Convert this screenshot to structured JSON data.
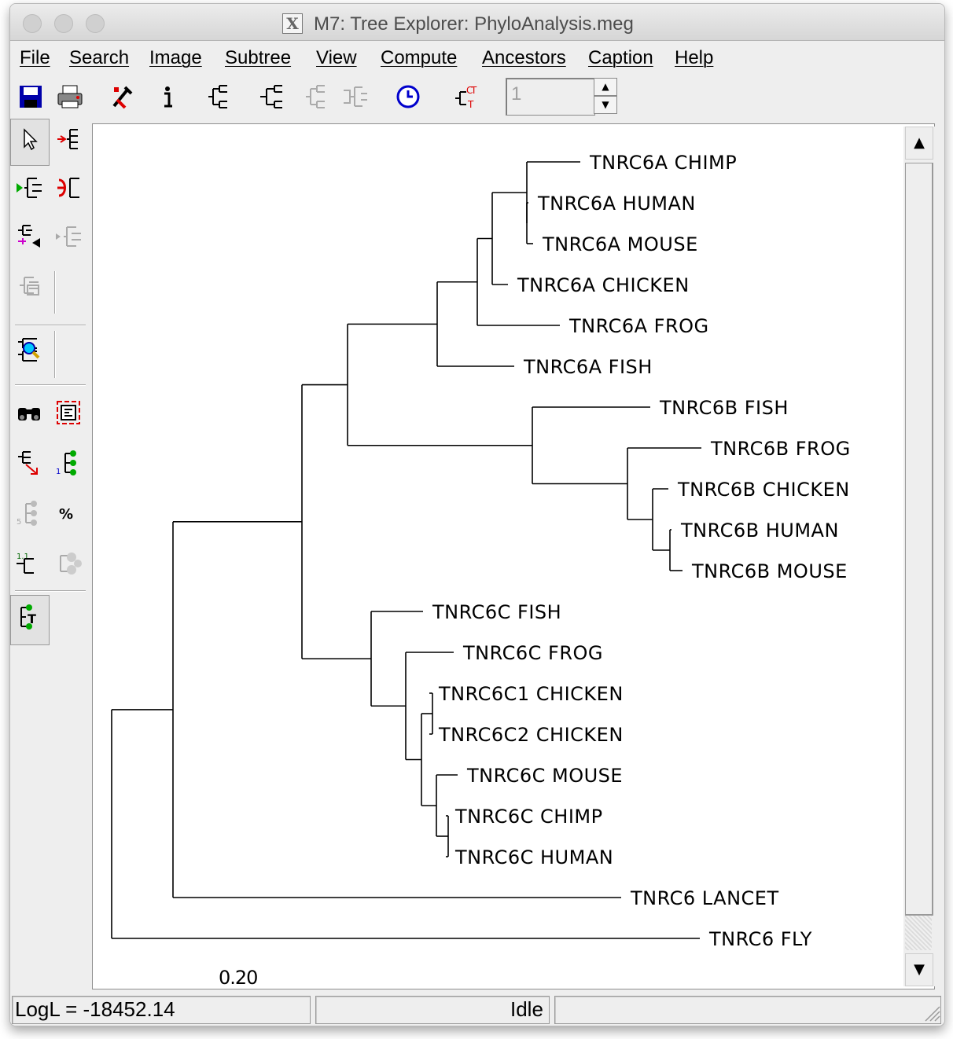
{
  "window": {
    "title": "M7: Tree Explorer: PhyloAnalysis.meg"
  },
  "menu": [
    "File",
    "Search",
    "Image",
    "Subtree",
    "View",
    "Compute",
    "Ancestors",
    "Caption",
    "Help"
  ],
  "toolbar": {
    "icons": [
      "save-icon",
      "print-icon",
      "tree-options-icon",
      "info-icon",
      "tree-style-icon",
      "tree-compress-icon",
      "tree-style-disabled-icon",
      "tree-flip-disabled-icon",
      "clock-icon",
      "taxon-names-icon"
    ],
    "spinner_value": "1"
  },
  "left_toolbar": {
    "icons": [
      "pointer-icon",
      "place-root-icon",
      "flip-subtree-icon",
      "compress-subtree-icon",
      "swap-subtree-icon",
      "subtree-disabled-icon",
      "subtree-window-disabled-icon",
      "search-taxa-icon",
      "binoculars-icon",
      "fit-window-icon",
      "resize-icon",
      "node-ids-icon",
      "branch-length-disabled-icon",
      "percent-icon",
      "scale-icon",
      "clock-disabled-icon",
      "show-tree-icon"
    ]
  },
  "colors": {
    "accent_blue": "#0000cc",
    "red": "#cc0000",
    "green": "#00aa00",
    "magenta": "#cc00cc"
  },
  "tree": {
    "taxa": [
      "TNRC6A CHIMP",
      "TNRC6A HUMAN",
      "TNRC6A MOUSE",
      "TNRC6A CHICKEN",
      "TNRC6A FROG",
      "TNRC6A FISH",
      "TNRC6B FISH",
      "TNRC6B FROG",
      "TNRC6B CHICKEN",
      "TNRC6B HUMAN",
      "TNRC6B MOUSE",
      "TNRC6C FISH",
      "TNRC6C FROG",
      "TNRC6C1 CHICKEN",
      "TNRC6C2 CHICKEN",
      "TNRC6C MOUSE",
      "TNRC6C CHIMP",
      "TNRC6C HUMAN",
      "TNRC6 LANCET",
      "TNRC6 FLY"
    ],
    "scale_label": "0.20"
  },
  "status": {
    "logl": "LogL = -18452.14",
    "state": "Idle"
  }
}
